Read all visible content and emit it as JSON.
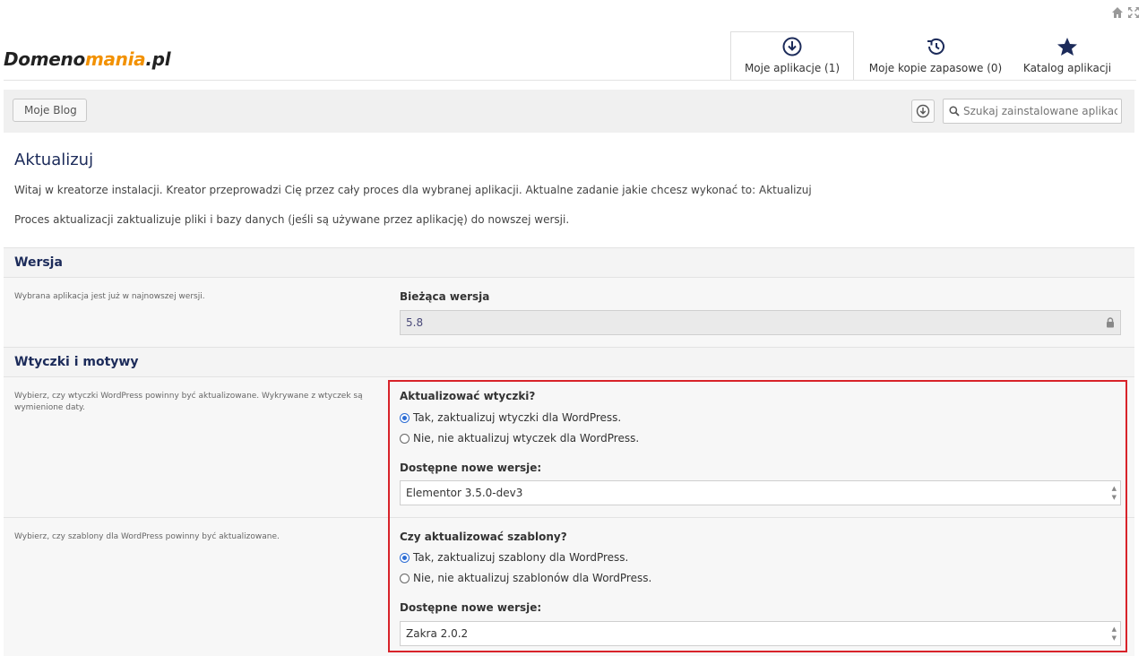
{
  "logo": {
    "part1": "Domeno",
    "part2": "mania",
    "part3": ".pl"
  },
  "tabs": [
    {
      "label": "Moje aplikacje (1)",
      "icon": "download-circle-icon"
    },
    {
      "label": "Moje kopie zapasowe (0)",
      "icon": "history-icon"
    },
    {
      "label": "Katalog aplikacji",
      "icon": "star-icon"
    }
  ],
  "toolbar": {
    "back_label": "Moje Blog",
    "search_placeholder": "Szukaj zainstalowane aplikac"
  },
  "page": {
    "title": "Aktualizuj",
    "intro": "Witaj w kreatorze instalacji. Kreator przeprowadzi Cię przez cały proces dla wybranej aplikacji. Aktualne zadanie jakie chcesz wykonać to: Aktualizuj",
    "description": "Proces aktualizacji zaktualizuje pliki i bazy danych (jeśli są używane przez aplikację) do nowszej wersji."
  },
  "version_section": {
    "heading": "Wersja",
    "desc": "Wybrana aplikacja jest już w najnowszej wersji.",
    "label": "Bieżąca wersja",
    "value": "5.8"
  },
  "plugins_section": {
    "heading": "Wtyczki i motywy",
    "plugins": {
      "desc": "Wybierz, czy wtyczki WordPress powinny być aktualizowane. Wykrywane z wtyczek są wymienione daty.",
      "question": "Aktualizować wtyczki?",
      "option_yes": "Tak, zaktualizuj wtyczki dla WordPress.",
      "option_no": "Nie, nie aktualizuj wtyczek dla WordPress.",
      "versions_label": "Dostępne nowe wersje:",
      "versions_value": "Elementor 3.5.0-dev3"
    },
    "themes": {
      "desc": "Wybierz, czy szablony dla WordPress powinny być aktualizowane.",
      "question": "Czy aktualizować szablony?",
      "option_yes": "Tak, zaktualizuj szablony dla WordPress.",
      "option_no": "Nie, nie aktualizuj szablonów dla WordPress.",
      "versions_label": "Dostępne nowe wersje:",
      "versions_value": "Zakra 2.0.2"
    }
  },
  "colors": {
    "accent": "#1c2b5a",
    "brand_orange": "#f29100",
    "highlight": "#d8232a"
  }
}
